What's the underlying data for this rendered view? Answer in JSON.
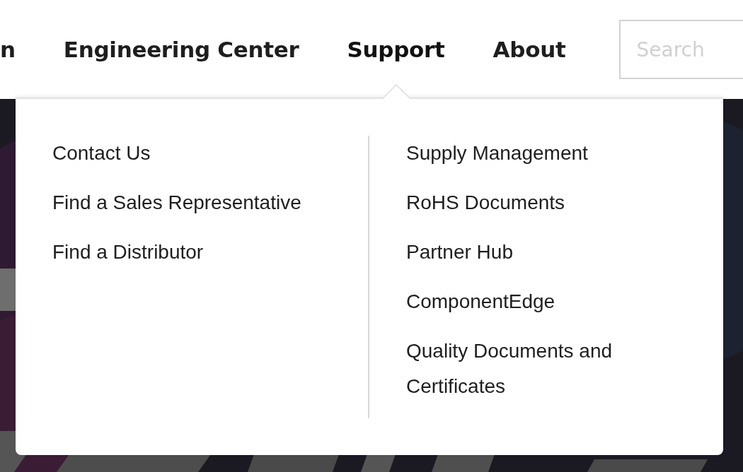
{
  "nav": [
    {
      "label": "n",
      "selected": false
    },
    {
      "label": "Engineering Center",
      "selected": false
    },
    {
      "label": "Support",
      "selected": true
    },
    {
      "label": "About",
      "selected": false
    }
  ],
  "search": {
    "placeholder": "Search"
  },
  "dropdown": {
    "columns": [
      {
        "items": [
          "Contact Us",
          "Find a Sales Representative",
          "Find a Distributor"
        ]
      },
      {
        "items": [
          "Supply Management",
          "RoHS Documents",
          "Partner Hub",
          "ComponentEdge",
          "Quality Documents and Certificates"
        ]
      }
    ]
  }
}
